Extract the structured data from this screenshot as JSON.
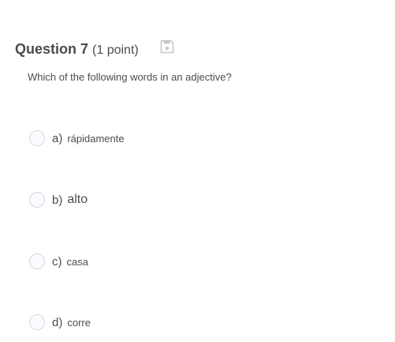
{
  "question": {
    "title": "Question 7",
    "points": "(1 point)",
    "text": "Which of the following words in an adjective?",
    "save_icon": "floppy-disk-icon"
  },
  "options": [
    {
      "letter": "a)",
      "text": "rápidamente"
    },
    {
      "letter": "b)",
      "text": "alto"
    },
    {
      "letter": "c)",
      "text": "casa"
    },
    {
      "letter": "d)",
      "text": "corre"
    }
  ],
  "colors": {
    "text": "#494c4e",
    "radio_border": "#d3d9e3",
    "radio_fill": "#f9fbfc",
    "icon": "#c4c8cc"
  }
}
